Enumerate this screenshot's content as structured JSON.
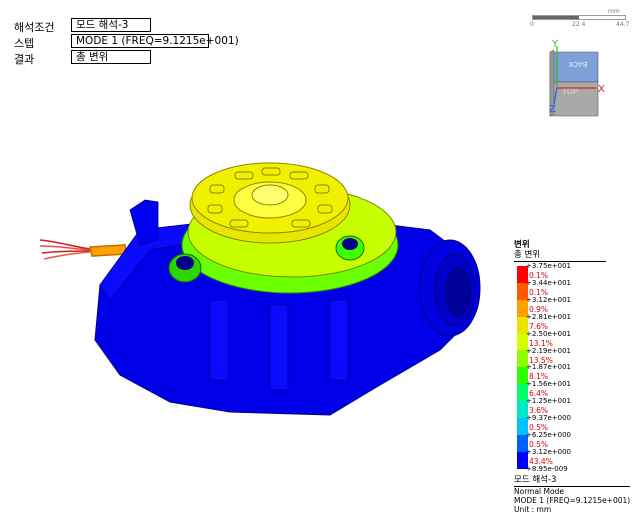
{
  "info": {
    "analysis_label": "해석조건",
    "analysis_value": "모드 해석-3",
    "step_label": "스텝",
    "step_value": "MODE 1 (FREQ=9.1215e+001)",
    "result_label": "결과",
    "result_value": "총 변위"
  },
  "scale": {
    "t0": "0",
    "t1": "22.4",
    "t2": "44.7",
    "unit": "mm"
  },
  "triad": {
    "y": "Y",
    "x": "X",
    "z": "Z",
    "back": "BACK",
    "top": "TOP"
  },
  "legend": {
    "title": "변위",
    "subtitle": "총 변위",
    "ticks": [
      "+3.75e+001",
      "+3.44e+001",
      "+3.12e+001",
      "+2.81e+001",
      "+2.50e+001",
      "+2.19e+001",
      "+1.87e+001",
      "+1.56e+001",
      "+1.25e+001",
      "+9.37e+000",
      "+6.25e+000",
      "+3.12e+000",
      "+8.95e-009"
    ],
    "percents": [
      "0.1%",
      "0.1%",
      "0.9%",
      "7.6%",
      "13.1%",
      "13.5%",
      "8.1%",
      "6.4%",
      "3.6%",
      "0.5%",
      "0.5%",
      "43.4%"
    ],
    "colors": [
      "#ff0000",
      "#ff5a00",
      "#ffa000",
      "#e8e600",
      "#d4ff00",
      "#8cff00",
      "#2cff00",
      "#00ff6a",
      "#00e8c8",
      "#00c0ff",
      "#0060ff",
      "#0000ff"
    ]
  },
  "footer": {
    "title": "모드 해석-3",
    "line1": "Normal Mode",
    "line2": "MODE 1 (FREQ=9.1215e+001)",
    "line3": "Unit : mm"
  }
}
